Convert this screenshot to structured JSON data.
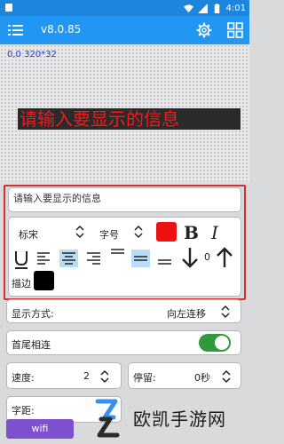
{
  "status_bar": {
    "time": "4:01"
  },
  "app_bar": {
    "version": "v8.0.85"
  },
  "preview": {
    "coords": "0,0 320*32",
    "led_text": "请输入要显示的信息",
    "led_color": "#ee1c1c"
  },
  "message_input": {
    "placeholder": "请输入要显示的信息",
    "value": ""
  },
  "format": {
    "font_family_label": "标宋",
    "font_size_label": "字号",
    "text_color": "#ee1111",
    "bold_label": "B",
    "italic_label": "I",
    "spacing_value": "0",
    "stroke_label": "描边",
    "stroke_color": "#000000",
    "selected_align": [
      "center-horizontal",
      "center-vertical"
    ]
  },
  "settings": {
    "display_mode_label": "显示方式:",
    "display_mode_value": "向左连移",
    "loop_label": "首尾相连",
    "loop_on": true,
    "accent": "#2e9a3c",
    "speed_label": "速度:",
    "speed_value": "2",
    "pause_label": "停留:",
    "pause_value": "0秒",
    "char_spacing_label": "字距:"
  },
  "bottom": {
    "wifi_label": "wifi"
  },
  "watermark": {
    "text": "欧凯手游网"
  },
  "colors": {
    "statusbar": "#1d85dc",
    "appbar": "#2196f3",
    "highlight": "#d32f2f",
    "wifi": "#7e4fcf"
  }
}
